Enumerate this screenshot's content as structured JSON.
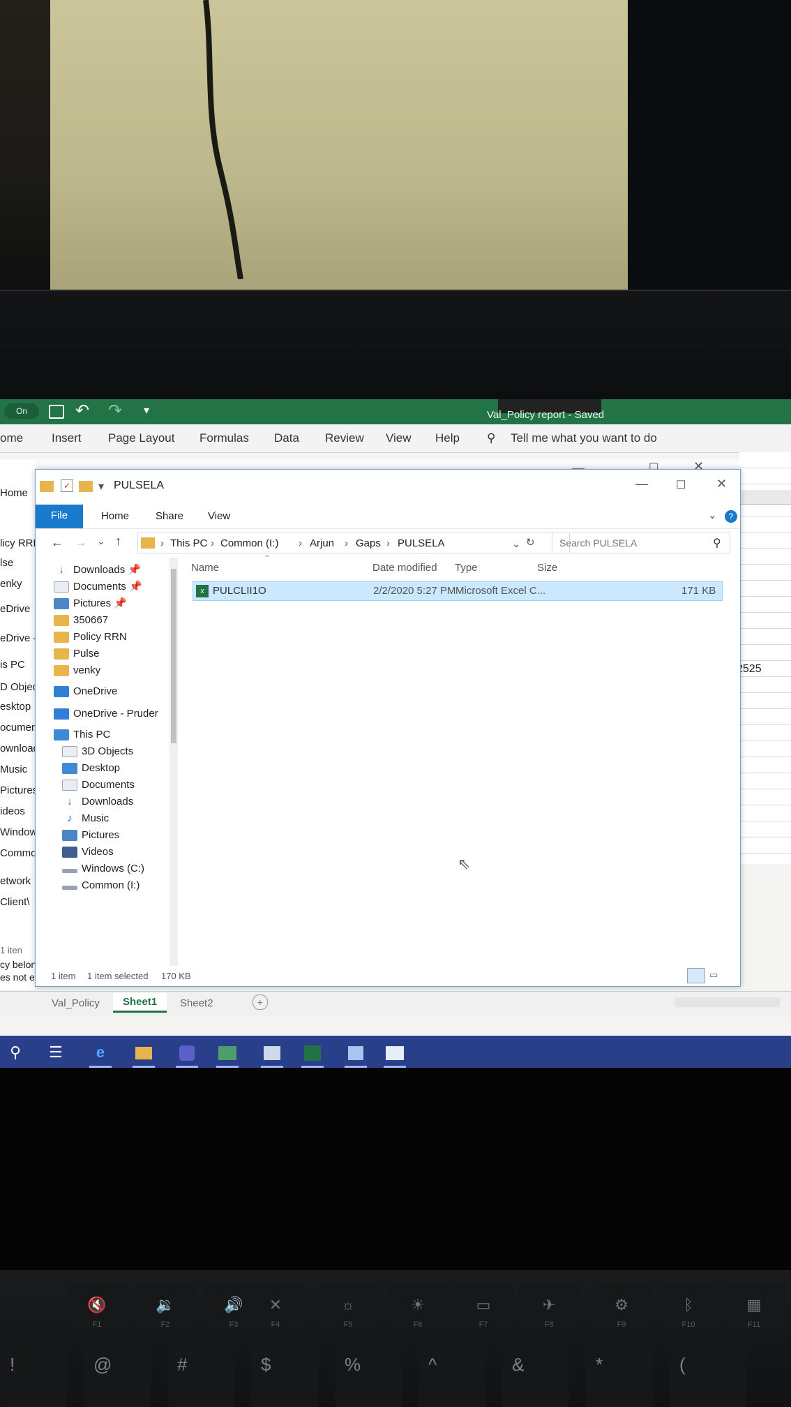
{
  "excel": {
    "quick_access": [
      "On",
      "↶",
      "↷"
    ],
    "title_overlay": "Val_Policy report - Saved",
    "tabs": [
      "ome",
      "Insert",
      "Page Layout",
      "Formulas",
      "Data",
      "Review",
      "View",
      "Help"
    ],
    "tell_me": "Tell me what you want to do",
    "cell_value": "2525",
    "sheet_tabs": [
      "Val_Policy",
      "Sheet1",
      "Sheet2"
    ],
    "active_sheet": "Sheet1",
    "add_sheet": "+"
  },
  "left_panel": {
    "header": "Home",
    "items": [
      "licy RRN",
      "lse",
      "enky",
      "eDrive",
      "eDrive - F",
      "is PC",
      "D Objects",
      "esktop",
      "ocument",
      "ownload",
      "Music",
      "Pictures",
      "ideos",
      "Windows (",
      "Common",
      "etwork",
      "Client\\"
    ],
    "status": [
      "1 iten",
      "cy belon",
      "es not ex"
    ]
  },
  "explorer": {
    "title": "PULSELA",
    "window_controls": {
      "minimize": "—",
      "maximize": "☐",
      "close": "✕"
    },
    "ribbon": {
      "file": "File",
      "home": "Home",
      "share": "Share",
      "view": "View"
    },
    "address": {
      "crumbs": [
        "This PC",
        "Common (I:)",
        "Arjun",
        "Gaps",
        "PULSELA"
      ],
      "search_placeholder": "Search PULSELA"
    },
    "nav": [
      {
        "label": "Downloads",
        "icon": "download-icon",
        "pinned": true
      },
      {
        "label": "Documents",
        "icon": "document-icon",
        "pinned": true
      },
      {
        "label": "Pictures",
        "icon": "pictures-icon",
        "pinned": true
      },
      {
        "label": "350667",
        "icon": "folder-icon"
      },
      {
        "label": "Policy RRN",
        "icon": "folder-icon"
      },
      {
        "label": "Pulse",
        "icon": "folder-icon"
      },
      {
        "label": "venky",
        "icon": "folder-icon"
      },
      {
        "label": "OneDrive",
        "icon": "onedrive-icon"
      },
      {
        "label": "OneDrive - Pruder",
        "icon": "onedrive-icon"
      },
      {
        "label": "This PC",
        "icon": "computer-icon"
      },
      {
        "label": "3D Objects",
        "icon": "3d-objects-icon"
      },
      {
        "label": "Desktop",
        "icon": "desktop-icon"
      },
      {
        "label": "Documents",
        "icon": "document-icon"
      },
      {
        "label": "Downloads",
        "icon": "download-icon"
      },
      {
        "label": "Music",
        "icon": "music-icon"
      },
      {
        "label": "Pictures",
        "icon": "pictures-icon"
      },
      {
        "label": "Videos",
        "icon": "videos-icon"
      },
      {
        "label": "Windows (C:)",
        "icon": "drive-icon"
      },
      {
        "label": "Common (I:)",
        "icon": "drive-icon"
      }
    ],
    "columns": {
      "name": "Name",
      "date": "Date modified",
      "type": "Type",
      "size": "Size"
    },
    "files": [
      {
        "name": "PULCLII1O",
        "date": "2/2/2020 5:27 PM",
        "type": "Microsoft Excel C...",
        "size": "171 KB"
      }
    ],
    "status": {
      "count": "1 item",
      "selected": "1 item selected",
      "size": "170 KB"
    }
  },
  "colors": {
    "excel_green": "#227447",
    "file_tab": "#1979ca",
    "taskbar": "#2a3f8a",
    "selection": "#cce8ff"
  },
  "taskbar": {
    "items": [
      "search-icon",
      "task-view-icon",
      "edge-icon",
      "file-explorer-icon",
      "teams-icon",
      "photos-icon",
      "app-icon",
      "excel-icon",
      "notes-icon",
      "remote-desktop-icon"
    ]
  },
  "keyboard": {
    "fkeys": [
      "F1",
      "F2",
      "F3",
      "F4",
      "F5",
      "F6",
      "F7",
      "F8",
      "F9",
      "F10",
      "F11"
    ],
    "symbols": [
      "!",
      "@",
      "#",
      "$",
      "%",
      "^",
      "&",
      "*",
      "("
    ]
  }
}
